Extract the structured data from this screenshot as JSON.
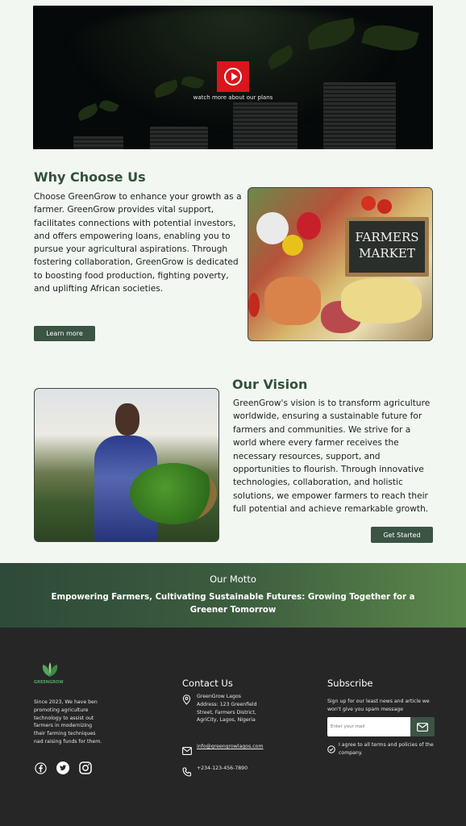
{
  "hero": {
    "caption": "watch more about our plans"
  },
  "why": {
    "title": "Why Choose Us",
    "text": "Choose GreenGrow to enhance your growth as a farmer. GreenGrow provides vital support, facilitates connections with potential investors, and offers empowering loans, enabling you to pursue your agricultural aspirations. Through fostering collaboration, GreenGrow is dedicated to boosting food production, fighting poverty, and uplifting African societies.",
    "button": "Learn more",
    "image_sign": "FARMERS MARKET"
  },
  "vision": {
    "title": "Our Vision",
    "text": "GreenGrow's vision is to transform agriculture worldwide, ensuring a sustainable future for farmers and communities. We strive for a world where every farmer receives the necessary resources, support, and opportunities to flourish. Through innovative technologies, collaboration, and holistic solutions, we empower farmers to reach their full potential and achieve remarkable growth.",
    "button": "Get Started"
  },
  "motto": {
    "title": "Our Motto",
    "text": "Empowering Farmers, Cultivating Sustainable Futures: Growing Together for a Greener Tomorrow"
  },
  "footer": {
    "brand": "GREENGROW",
    "about": "Since 2023, We have ben promoting agriculture technology to assist out farmers in modernizing their farming techniques nad raising funds for them.",
    "socials": [
      "facebook-icon",
      "twitter-icon",
      "instagram-icon"
    ],
    "contact": {
      "title": "Contact Us",
      "address": "GreenGrow Lagos Address: 123 Greenfield Street, Farmers District, AgriCity, Lagos, Nigeria",
      "email": "info@greengrowlagos.com",
      "phone": "+234-123-456-7890"
    },
    "subscribe": {
      "title": "Subscribe",
      "text": "Sign up for our least news and article we won't give you spam message",
      "placeholder": "Enter your mail",
      "agree": "I agree to all terms and policies of the company."
    }
  },
  "colors": {
    "accent": "#3b5444",
    "heading": "#33503b",
    "footer_bg": "#262626",
    "play_red": "#d8161c"
  }
}
